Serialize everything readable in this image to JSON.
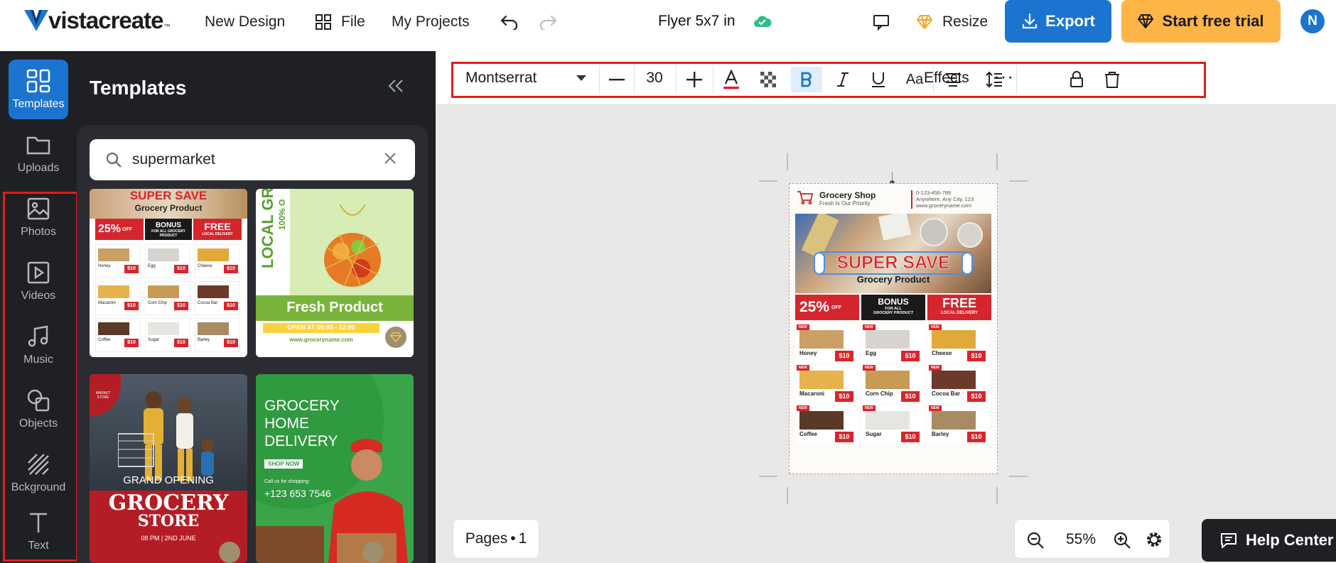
{
  "app": {
    "brand": "vistacreate",
    "brand_tm": "™"
  },
  "topbar": {
    "new_design": "New Design",
    "file": "File",
    "my_projects": "My Projects",
    "doc_title": "Flyer 5x7 in",
    "resize": "Resize",
    "export": "Export",
    "trial": "Start free trial",
    "avatar_initial": "N"
  },
  "rail": [
    {
      "label": "Templates",
      "icon": "templates-icon"
    },
    {
      "label": "Uploads",
      "icon": "folder-icon"
    },
    {
      "label": "Photos",
      "icon": "image-icon"
    },
    {
      "label": "Videos",
      "icon": "play-icon"
    },
    {
      "label": "Music",
      "icon": "music-note-icon"
    },
    {
      "label": "Objects",
      "icon": "shapes-icon"
    },
    {
      "label": "Bckground",
      "icon": "background-icon"
    },
    {
      "label": "Text",
      "icon": "text-icon"
    }
  ],
  "panel": {
    "title": "Templates",
    "search_value": "supermarket"
  },
  "toolbar": {
    "font": "Montserrat",
    "size": "30",
    "effects": "Effects",
    "more": "···"
  },
  "template_cards": {
    "card1": {
      "title": "SUPER SAVE",
      "sub": "Grocery Product",
      "off": "25%",
      "off_small": "OFF",
      "bonus": "BONUS",
      "bonus_sub": "FOR ALL GROCERY PRODUCT",
      "free": "FREE",
      "free_sub": "LOCAL DELIVERY"
    },
    "card2": {
      "vertical": "LOCAL GRO",
      "vertical2": "100% O",
      "title": "Fresh Product",
      "open": "OPEN AT  09:00 - 12:00",
      "url": "www.groceryname.com"
    },
    "card3": {
      "badge": "MARKET STORE",
      "opening": "GRAND OPENING",
      "title1": "GROCERY",
      "title2": "STORE",
      "date": "08 PM | 2ND JUNE"
    },
    "card4": {
      "line1": "GROCERY",
      "line2": "HOME",
      "line3": "DELIVERY",
      "shop": "SHOP NOW",
      "call": "Call us for shopping:",
      "phone": "+123 653 7546"
    }
  },
  "flyer": {
    "shop_name": "Grocery Shop",
    "tagline": "Fresh Is Our Priority",
    "phone": "0-123-456-789",
    "address": "Anywhere, Any City, 123",
    "url": "www.groceryname.com",
    "headline": "SUPER SAVE",
    "subheadline": "Grocery Product",
    "promo_off": "25%",
    "promo_off_small": "OFF",
    "promo_bonus": "BONUS",
    "promo_bonus_sub1": "FOR ALL",
    "promo_bonus_sub2": "GROCERY PRODUCT",
    "promo_free": "FREE",
    "promo_free_sub": "LOCAL DELIVERY",
    "new_tag": "NEW",
    "price": "$10",
    "items": [
      "Honey",
      "Egg",
      "Cheese",
      "Macaroni",
      "Corn Chip",
      "Cocoa Bar",
      "Coffee",
      "Sugar",
      "Barley"
    ]
  },
  "bottom": {
    "pages_label": "Pages",
    "pages_count": "1",
    "zoom": "55%",
    "help": "Help Center"
  },
  "colors": {
    "accent": "#1b74d0",
    "trial": "#fdb548",
    "dark": "#1f2024",
    "highlight": "#e21d1d",
    "cloud": "#2fc08a"
  }
}
